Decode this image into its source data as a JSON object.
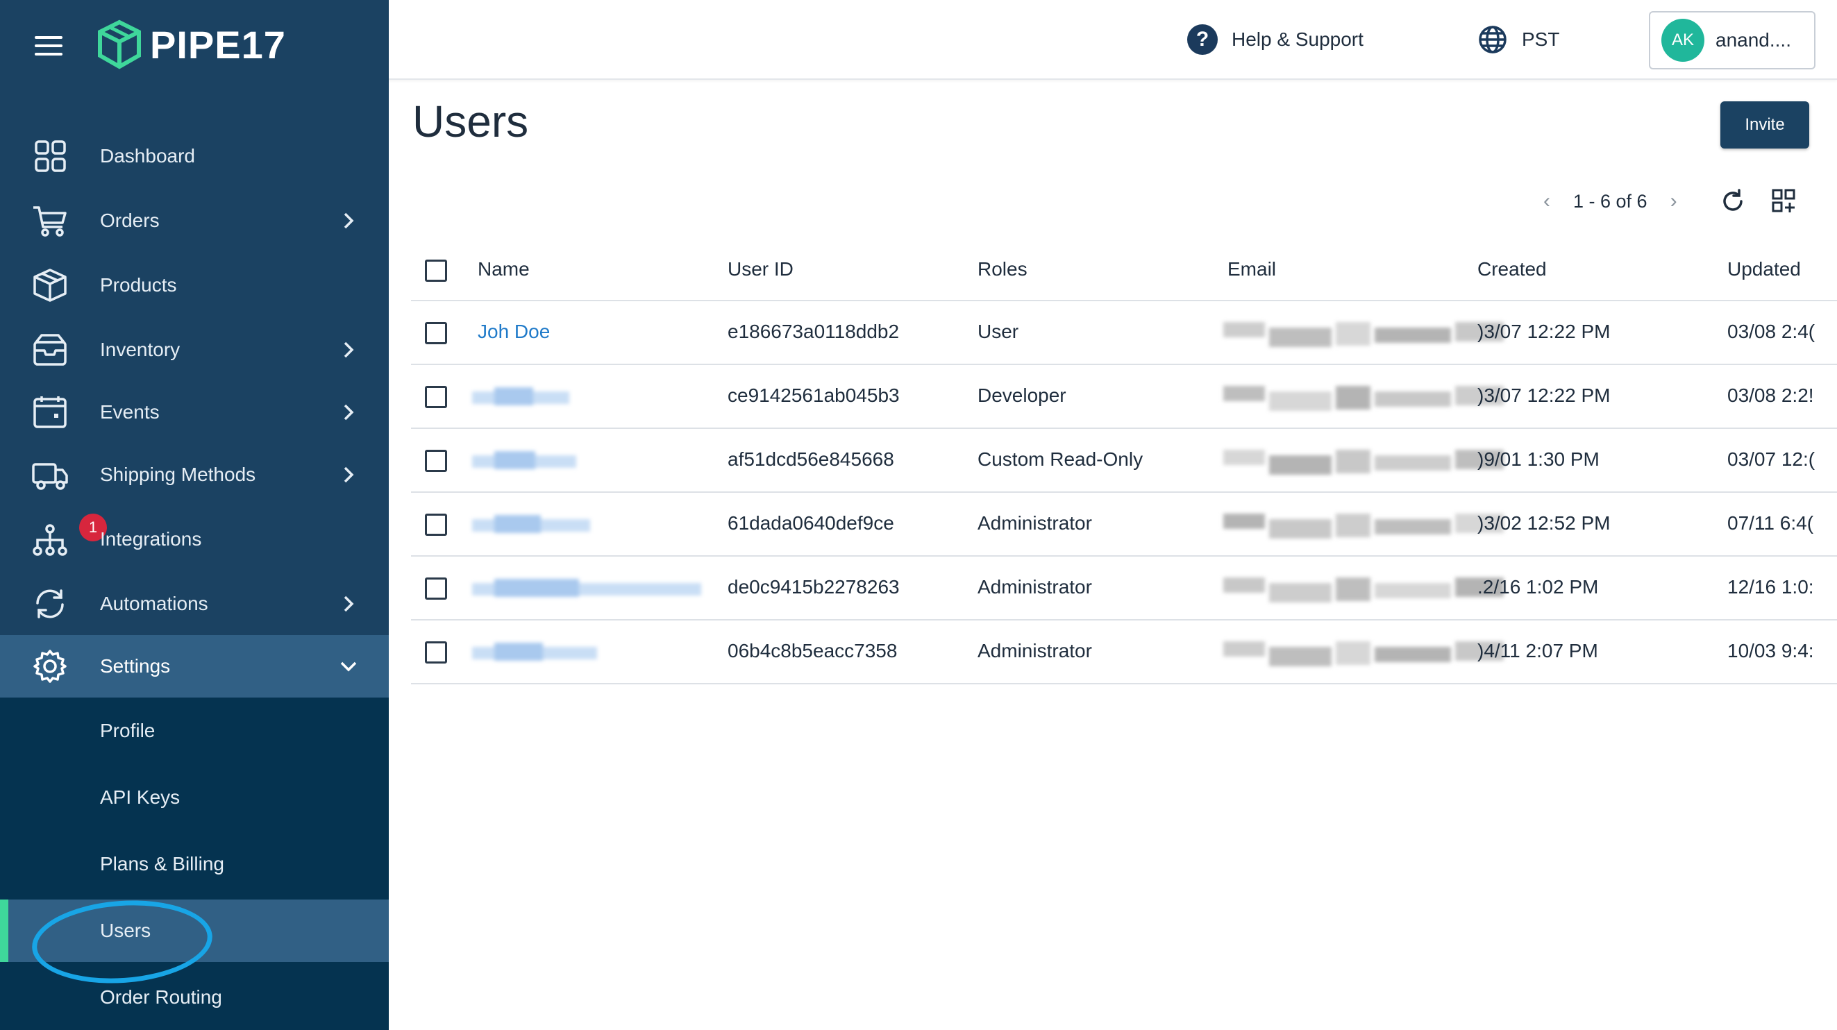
{
  "brand": {
    "name": "PIPE17",
    "accent": "#3fd79b"
  },
  "sidebar": {
    "items": [
      {
        "label": "Dashboard",
        "icon": "dashboard-icon",
        "has_chevron": false
      },
      {
        "label": "Orders",
        "icon": "cart-icon",
        "has_chevron": true
      },
      {
        "label": "Products",
        "icon": "box-icon",
        "has_chevron": false
      },
      {
        "label": "Inventory",
        "icon": "inventory-icon",
        "has_chevron": true
      },
      {
        "label": "Events",
        "icon": "calendar-icon",
        "has_chevron": true
      },
      {
        "label": "Shipping Methods",
        "icon": "truck-icon",
        "has_chevron": true
      },
      {
        "label": "Integrations",
        "icon": "integrations-icon",
        "has_chevron": false,
        "badge": "1"
      },
      {
        "label": "Automations",
        "icon": "sync-icon",
        "has_chevron": true
      },
      {
        "label": "Settings",
        "icon": "gear-icon",
        "has_chevron": true,
        "expanded": true
      }
    ],
    "settings_sub": [
      "Profile",
      "API Keys",
      "Plans & Billing",
      "Users",
      "Order Routing"
    ],
    "active_sub": "Users"
  },
  "topbar": {
    "help_label": "Help & Support",
    "help_glyph": "?",
    "timezone": "PST",
    "avatar_initials": "AK",
    "user_name": "anand...."
  },
  "page": {
    "title": "Users",
    "invite_label": "Invite",
    "pagination": "1 - 6 of 6",
    "prev_glyph": "‹",
    "next_glyph": "›"
  },
  "table": {
    "columns": [
      "Name",
      "User ID",
      "Roles",
      "Email",
      "Created",
      "Updated"
    ],
    "rows": [
      {
        "name": "Joh Doe",
        "user_id": "e186673a0118ddb2",
        "role": "User",
        "created": ")3/07 12:22 PM",
        "updated": "03/08 2:4("
      },
      {
        "name": "",
        "user_id": "ce9142561ab045b3",
        "role": "Developer",
        "created": ")3/07 12:22 PM",
        "updated": "03/08 2:2!"
      },
      {
        "name": "",
        "user_id": "af51dcd56e845668",
        "role": "Custom Read-Only",
        "created": ")9/01 1:30 PM",
        "updated": "03/07 12:("
      },
      {
        "name": "",
        "user_id": "61dada0640def9ce",
        "role": "Administrator",
        "created": ")3/02 12:52 PM",
        "updated": "07/11 6:4("
      },
      {
        "name": "",
        "user_id": "de0c9415b2278263",
        "role": "Administrator",
        "created": ".2/16 1:02 PM",
        "updated": "12/16 1:0:"
      },
      {
        "name": "",
        "user_id": "06b4c8b5eacc7358",
        "role": "Administrator",
        "created": ")4/11 2:07 PM",
        "updated": "10/03 9:4:"
      }
    ]
  }
}
